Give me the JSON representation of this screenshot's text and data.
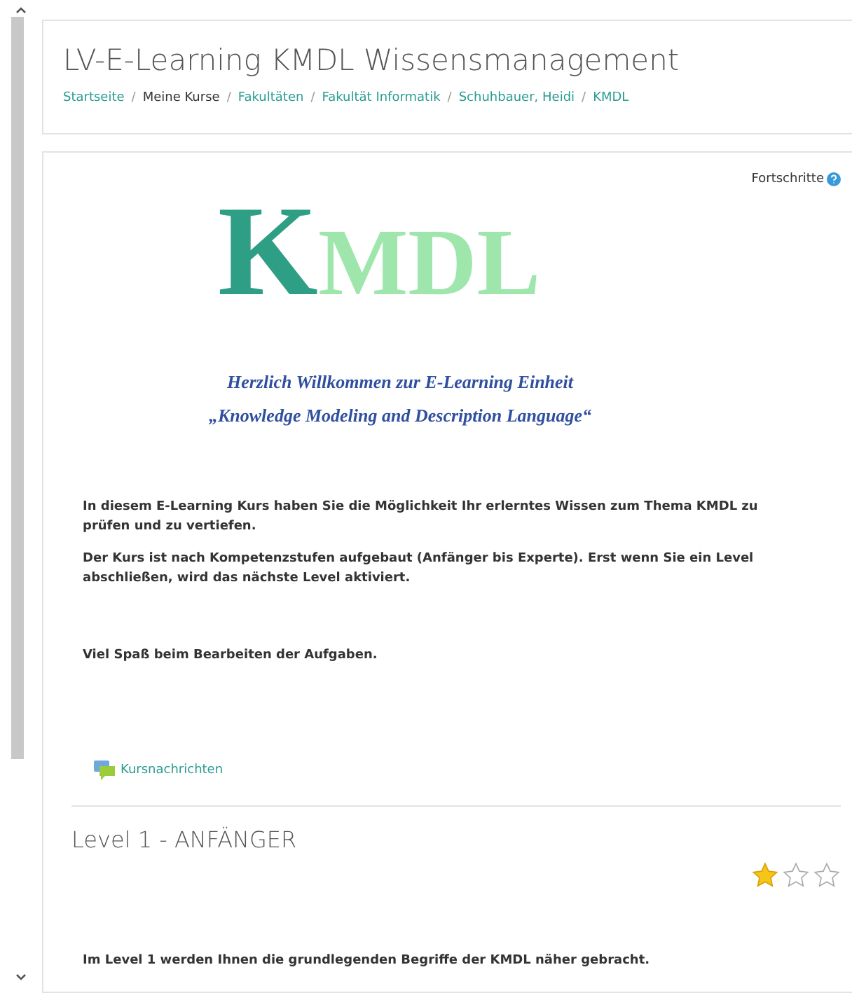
{
  "header": {
    "title": "LV-E-Learning KMDL Wissensmanagement",
    "breadcrumbs": [
      {
        "label": "Startseite",
        "link": true
      },
      {
        "label": "Meine Kurse",
        "link": false
      },
      {
        "label": "Fakultäten",
        "link": true
      },
      {
        "label": "Fakultät Informatik",
        "link": true
      },
      {
        "label": "Schuhbauer, Heidi",
        "link": true
      },
      {
        "label": "KMDL",
        "link": true
      }
    ],
    "separator": "/"
  },
  "progress": {
    "label": "Fortschritte"
  },
  "logo": {
    "initial": "K",
    "rest": "MDL"
  },
  "welcome": [
    "Herzlich Willkommen zur E-Learning Einheit",
    "„Knowledge Modeling and Description Language“"
  ],
  "intro": [
    "In diesem E-Learning Kurs haben Sie die Möglichkeit Ihr erlerntes Wissen zum Thema KMDL zu prüfen und zu vertiefen.",
    "Der Kurs ist nach Kompetenzstufen aufgebaut (Anfänger bis Experte). Erst wenn Sie ein Level abschließen, wird das nächste Level aktiviert."
  ],
  "closing": "Viel Spaß beim Bearbeiten der Aufgaben.",
  "news_link": "Kursnachrichten",
  "section": {
    "title": "Level 1 - ANFÄNGER",
    "stars": 1,
    "text": "Im Level 1 werden Ihnen die grundlegenden Begriffe der KMDL näher gebracht."
  }
}
